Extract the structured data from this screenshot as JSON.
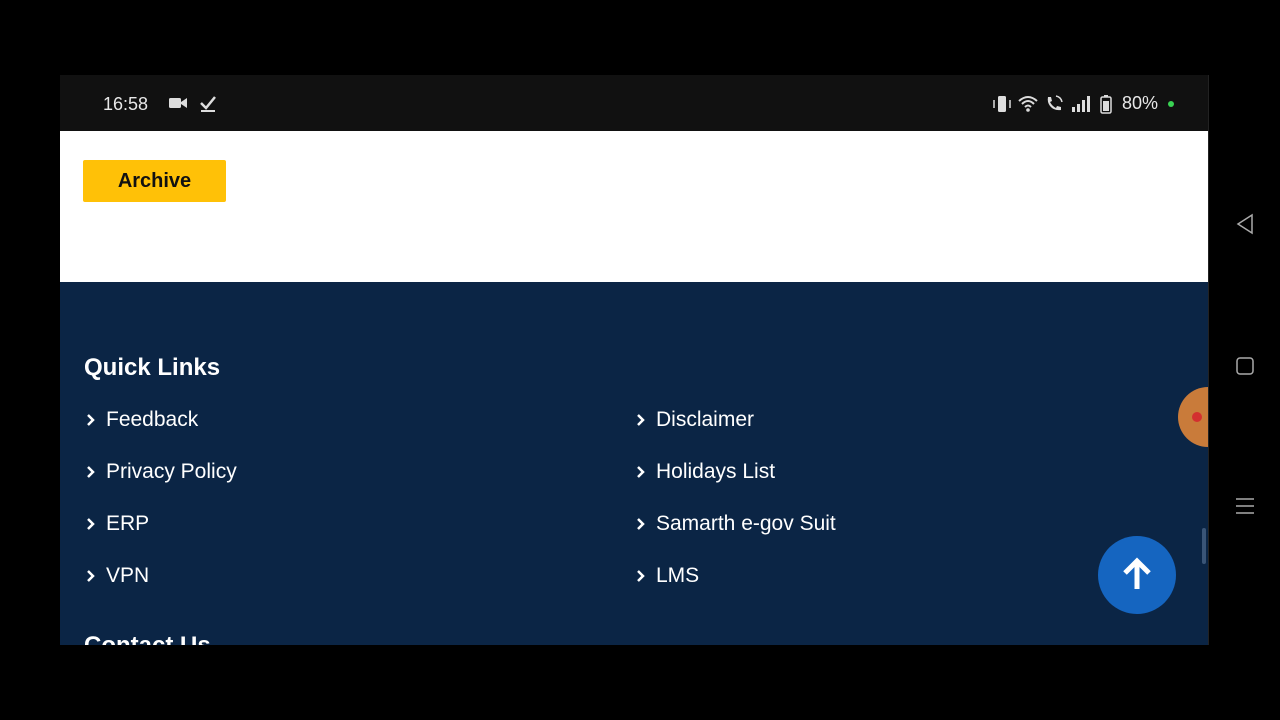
{
  "status_bar": {
    "time": "16:58",
    "battery": "80%",
    "left_icons": [
      "video-icon",
      "check-icon"
    ],
    "right_icons": [
      "vibrate-icon",
      "wifi-icon",
      "wifi-call-icon",
      "signal-icon",
      "battery-icon"
    ]
  },
  "page": {
    "archive_label": "Archive",
    "quick_links_title": "Quick Links",
    "links_left": [
      "Feedback",
      "Privacy Policy",
      "ERP",
      "VPN"
    ],
    "links_right": [
      "Disclaimer",
      "Holidays List",
      "Samarth e-gov Suit",
      "LMS"
    ],
    "next_heading": "Contact Us"
  },
  "colors": {
    "footer_bg": "#0b2545",
    "archive_button": "#ffc107",
    "scroll_top_button": "#1565c0"
  },
  "nav_buttons": [
    "back-icon",
    "home-icon",
    "recents-icon"
  ]
}
